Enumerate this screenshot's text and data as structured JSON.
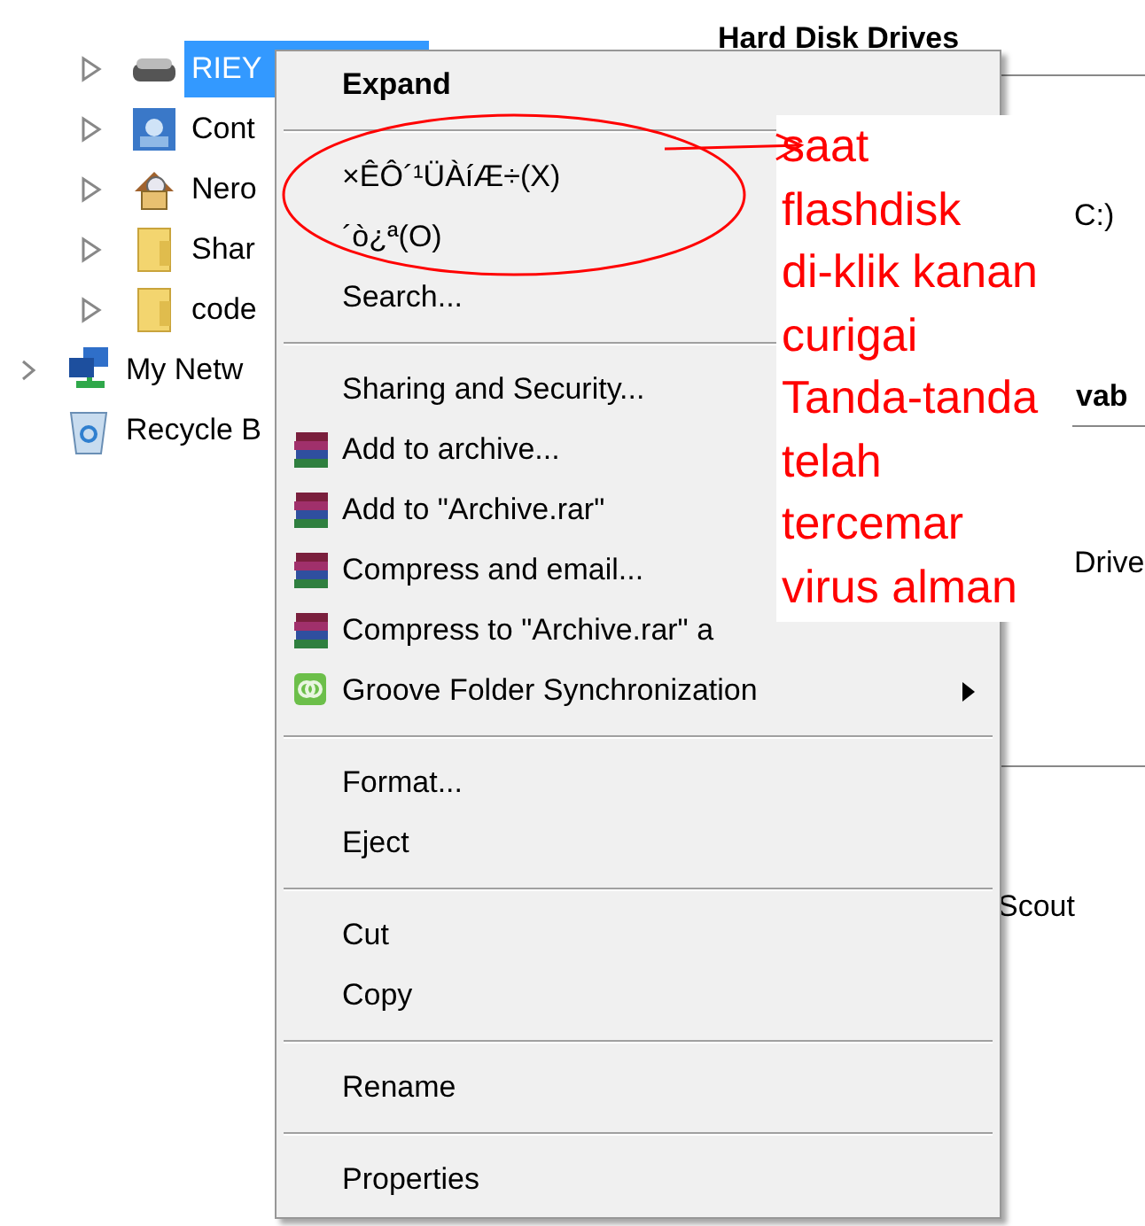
{
  "tree": {
    "subitems": [
      {
        "label": "RIEY",
        "expandable": true,
        "selected": true
      },
      {
        "label": "Cont",
        "expandable": true,
        "selected": false
      },
      {
        "label": "Nero",
        "expandable": true,
        "selected": false
      },
      {
        "label": "Shar",
        "expandable": true,
        "selected": false
      },
      {
        "label": "code",
        "expandable": true,
        "selected": false
      }
    ],
    "items": [
      {
        "label": "My Netw",
        "expandable": true,
        "selected": false
      },
      {
        "label": "Recycle B",
        "expandable": false,
        "selected": false
      }
    ]
  },
  "right_pane": [
    {
      "kind": "heading",
      "text": "Hard Disk Drives"
    },
    {
      "kind": "label",
      "text": "C:)"
    },
    {
      "kind": "heading",
      "text": "vab"
    },
    {
      "kind": "label",
      "text": "Drive"
    },
    {
      "kind": "label",
      "text": "Scout"
    }
  ],
  "context_menu": [
    {
      "kind": "item",
      "label": "Expand",
      "bold": true
    },
    {
      "kind": "separator"
    },
    {
      "kind": "item",
      "label": "×ÊÔ´¹ÜÀíÆ÷(X)",
      "bold": false
    },
    {
      "kind": "item",
      "label": "´ò¿ª(O)",
      "bold": false
    },
    {
      "kind": "item",
      "label": "Search...",
      "bold": false
    },
    {
      "kind": "separator"
    },
    {
      "kind": "item",
      "label": "Sharing and Security...",
      "bold": false
    },
    {
      "kind": "archive",
      "label": "Add to archive..."
    },
    {
      "kind": "archive",
      "label": "Add to \"Archive.rar\""
    },
    {
      "kind": "archive",
      "label": "Compress and email..."
    },
    {
      "kind": "archive",
      "label": "Compress to \"Archive.rar\" a"
    },
    {
      "kind": "sync",
      "label": "Groove Folder Synchronization",
      "submenu": true
    },
    {
      "kind": "separator"
    },
    {
      "kind": "item",
      "label": "Format...",
      "bold": false
    },
    {
      "kind": "item",
      "label": "Eject",
      "bold": false
    },
    {
      "kind": "separator"
    },
    {
      "kind": "item",
      "label": "Cut",
      "bold": false
    },
    {
      "kind": "item",
      "label": "Copy",
      "bold": false
    },
    {
      "kind": "separator"
    },
    {
      "kind": "item",
      "label": "Rename",
      "bold": false
    },
    {
      "kind": "separator"
    },
    {
      "kind": "item",
      "label": "Properties",
      "bold": false
    }
  ],
  "annotation": {
    "text": "saat\nflashdisk\ndi-klik kanan\ncurigai\nTanda-tanda\ntelah\ntercemar\nvirus alman"
  }
}
